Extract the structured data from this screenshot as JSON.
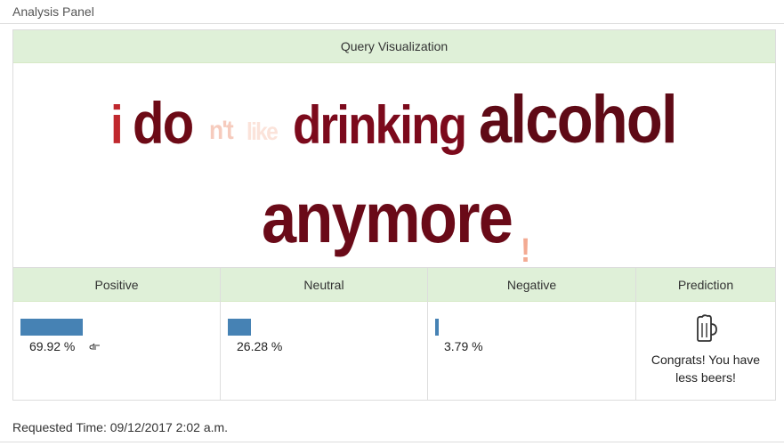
{
  "panel": {
    "title": "Analysis Panel"
  },
  "visualization": {
    "header": "Query Visualization",
    "words": [
      {
        "text": "i",
        "color": "#c0282e"
      },
      {
        "text": "do",
        "color": "#6d0a16"
      },
      {
        "text": "n't",
        "color": "#f6cbbd"
      },
      {
        "text": "like",
        "color": "#fbe3da"
      },
      {
        "text": "drinking",
        "color": "#7c0a1c"
      },
      {
        "text": "alcohol",
        "color": "#5f0a16"
      },
      {
        "text": "anymore",
        "color": "#6a0a18"
      },
      {
        "text": "!",
        "color": "#f3aa92"
      }
    ]
  },
  "sentiment": {
    "columns": [
      {
        "label": "Positive",
        "percent": "69.92 %",
        "fraction": 0.6992,
        "icon": "pointing-hand-icon"
      },
      {
        "label": "Neutral",
        "percent": "26.28 %",
        "fraction": 0.2628
      },
      {
        "label": "Negative",
        "percent": "3.79 %",
        "fraction": 0.0379
      },
      {
        "label": "Prediction",
        "icon": "beer-mug-icon",
        "text": "Congrats! You have less beers!"
      }
    ],
    "bar_color": "#4682b4"
  },
  "footer": {
    "requested_time": "Requested Time: 09/12/2017 2:02 a.m."
  }
}
